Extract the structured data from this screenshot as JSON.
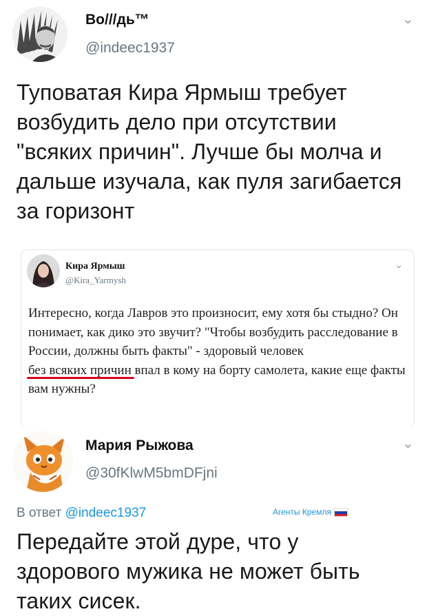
{
  "tweet1": {
    "name": "Во///дь™",
    "handle": "@indeec1937",
    "text": "Туповатая Кира Ярмыш требует возбудить дело при отсутствии \"всяких причин\". Лучше бы молча и дальше изучала, как пуля загибается за горизонт"
  },
  "quoted": {
    "name": "Кира Ярмыш",
    "handle": "@Kira_Yarmysh",
    "text_before": "Интересно, когда Лавров это произносит, ему хотя бы стыдно? Он понимает, как дико это звучит? \"Чтобы возбудить расследование в России, должны быть факты\" - здоровый человек ",
    "text_underlined": "без всяких причин",
    "text_after": " впал в кому на борту самолета, какие еще факты вам нужны?"
  },
  "reply": {
    "name": "Мария Рыжова",
    "handle": "@30fKlwM5bmDFjni",
    "in_reply_prefix": "В ответ ",
    "in_reply_handle": "@indeec1937",
    "tag": "Агенты Кремля",
    "text": "Передайте этой дуре, что у здорового мужика не может быть таких сисек."
  },
  "icons": {
    "chevron": "⌄"
  },
  "colors": {
    "handle": "#6a7680",
    "link": "#1b95e0",
    "underline": "#d6001c"
  }
}
